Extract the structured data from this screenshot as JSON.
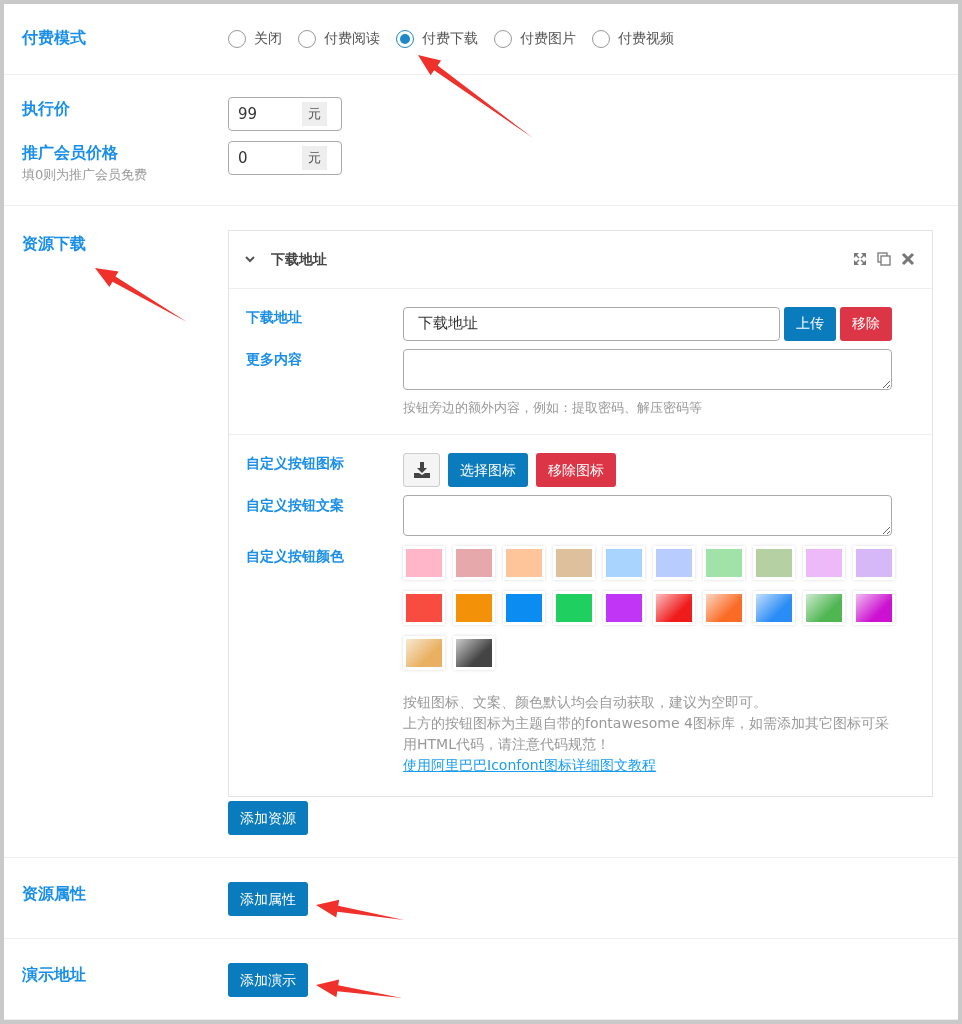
{
  "pay_mode": {
    "label": "付费模式",
    "options": [
      {
        "label": "关闭",
        "selected": false
      },
      {
        "label": "付费阅读",
        "selected": false
      },
      {
        "label": "付费下载",
        "selected": true
      },
      {
        "label": "付费图片",
        "selected": false
      },
      {
        "label": "付费视频",
        "selected": false
      }
    ]
  },
  "price": {
    "label": "执行价",
    "value": "99",
    "unit": "元"
  },
  "promo_price": {
    "label": "推广会员价格",
    "hint": "填0则为推广会员免费",
    "value": "0",
    "unit": "元"
  },
  "resource_download": {
    "label": "资源下载",
    "item": {
      "title": "下载地址",
      "expanded": true,
      "url": {
        "label": "下载地址",
        "value": "下载地址",
        "buttons": [
          "上传",
          "移除"
        ]
      },
      "more": {
        "label": "更多内容",
        "hint": "按钮旁边的额外内容，例如：提取密码、解压密码等"
      },
      "icon": {
        "label": "自定义按钮图标",
        "buttons": [
          "选择图标",
          "移除图标"
        ]
      },
      "text": {
        "label": "自定义按钮文案"
      },
      "color": {
        "label": "自定义按钮颜色",
        "swatches": [
          {
            "kind": "solid",
            "color": "#ffb6c8"
          },
          {
            "kind": "solid",
            "color": "#e6a8ab"
          },
          {
            "kind": "solid",
            "color": "#ffc59a"
          },
          {
            "kind": "solid",
            "color": "#dfc09c"
          },
          {
            "kind": "solid",
            "color": "#a8d4fe"
          },
          {
            "kind": "solid",
            "color": "#b8ccfe"
          },
          {
            "kind": "solid",
            "color": "#a0e2a8"
          },
          {
            "kind": "solid",
            "color": "#b5d0a2"
          },
          {
            "kind": "solid",
            "color": "#eeb9f8"
          },
          {
            "kind": "solid",
            "color": "#d6b8f8"
          },
          {
            "kind": "solid",
            "color": "#f84c40"
          },
          {
            "kind": "solid",
            "color": "#f39208"
          },
          {
            "kind": "solid",
            "color": "#0a8cf0"
          },
          {
            "kind": "solid",
            "color": "#1fcf5f"
          },
          {
            "kind": "solid",
            "color": "#c135f6"
          },
          {
            "kind": "gradient",
            "color": "#f01c1c"
          },
          {
            "kind": "gradient",
            "color": "#fa6c26"
          },
          {
            "kind": "gradient",
            "color": "#2a8cf5"
          },
          {
            "kind": "gradient",
            "color": "#4fb652"
          },
          {
            "kind": "gradient",
            "color": "#cc12d0"
          },
          {
            "kind": "gradient",
            "color": "#e8b060"
          },
          {
            "kind": "gradient",
            "color": "#444444"
          }
        ],
        "notes": [
          "按钮图标、文案、颜色默认均会自动获取，建议为空即可。",
          "上方的按钮图标为主题自带的fontawesome 4图标库，如需添加其它图标可采用HTML代码，请注意代码规范！"
        ],
        "link": "使用阿里巴巴Iconfont图标详细图文教程"
      }
    },
    "add_button": "添加资源"
  },
  "resource_attributes": {
    "label": "资源属性",
    "button": "添加属性"
  },
  "demo_url": {
    "label": "演示地址",
    "button": "添加演示"
  }
}
